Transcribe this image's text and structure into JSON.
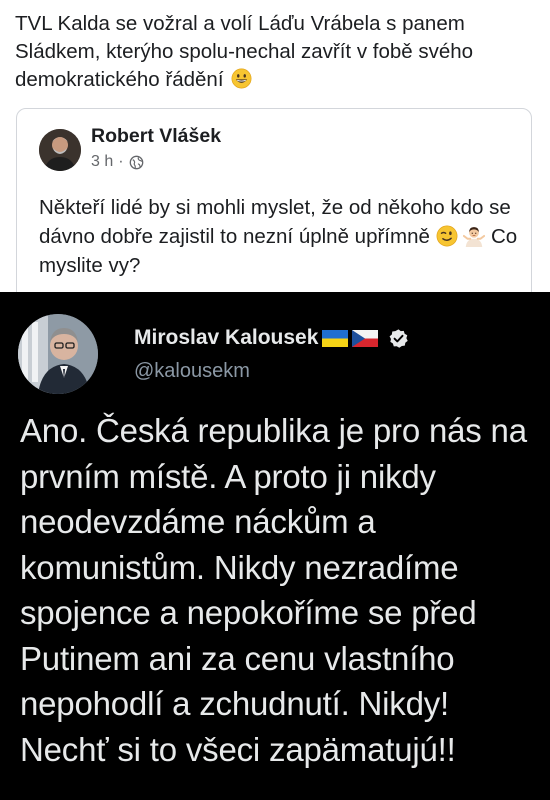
{
  "top_post": {
    "text": "TVL Kalda se vožral a volí Láďu Vrábela s panem Sládkem, kterýho spolu-nechal zavřít v fobě svého demokratického řádění",
    "trailing_emoji": "grinning-face-emoji",
    "shared_post": {
      "author": "Robert Vlášek",
      "time": "3 h",
      "separator": "·",
      "audience_icon": "globe-icon",
      "body": "Někteří lidé by si mohli myslet, že od někoho kdo se dávno dobře zajistil to nezní úplně upřímně",
      "emojis": [
        "winking-face-emoji",
        "person-shrugging-emoji"
      ],
      "body_end": "Co myslite vy?"
    }
  },
  "tweet": {
    "author_name": "Miroslav Kalousek",
    "flags": [
      "ukraine-flag-icon",
      "czech-flag-icon"
    ],
    "verified_icon": "verified-badge-icon",
    "handle": "@kalousekm",
    "text": "Ano. Česká republika je pro nás na prvním místě. A proto ji nikdy neodevzdáme náckům a komunistům. Nikdy nezradíme spojence a nepokoříme se před Putinem ani za cenu vlastního nepohodlí a zchudnutí. Nikdy! Nechť si to všeci zapämatujú!!"
  },
  "colors": {
    "fb_text": "#1c1e21",
    "fb_meta": "#65676b",
    "card_border": "#d3d6db",
    "tw_background": "#000000",
    "tw_text": "#e7e9ea",
    "tw_handle": "#8b98a5"
  }
}
